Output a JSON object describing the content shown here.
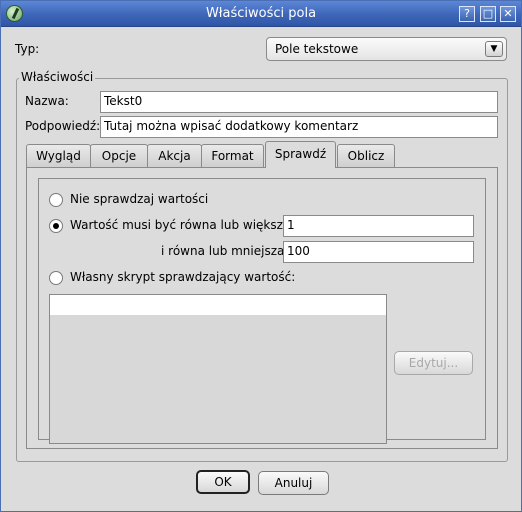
{
  "window": {
    "title": "Właściwości pola",
    "help_label": "?",
    "maximize_label": "□",
    "close_label": "✕"
  },
  "type": {
    "label": "Typ:",
    "value": "Pole tekstowe"
  },
  "properties": {
    "group_label": "Właściwości",
    "name_label": "Nazwa:",
    "name_value": "Tekst0",
    "tooltip_label": "Podpowiedź:",
    "tooltip_value": "Tutaj można wpisać dodatkowy komentarz"
  },
  "tabs": [
    {
      "label": "Wygląd"
    },
    {
      "label": "Opcje"
    },
    {
      "label": "Akcja"
    },
    {
      "label": "Format"
    },
    {
      "label": "Sprawdź",
      "active": true
    },
    {
      "label": "Oblicz"
    }
  ],
  "validate": {
    "no_check_label": "Nie sprawdzaj wartości",
    "range_label": "Wartość musi być równa lub większa:",
    "range_min": "1",
    "range_max_label": "i równa lub mniejsza:",
    "range_max": "100",
    "custom_script_label": "Własny skrypt sprawdzający wartość:",
    "selected": "range",
    "edit_label": "Edytuj..."
  },
  "footer": {
    "ok_label": "OK",
    "cancel_label": "Anuluj"
  },
  "icons": {
    "app": "app-icon",
    "dropdown": "chevron-down-icon"
  }
}
